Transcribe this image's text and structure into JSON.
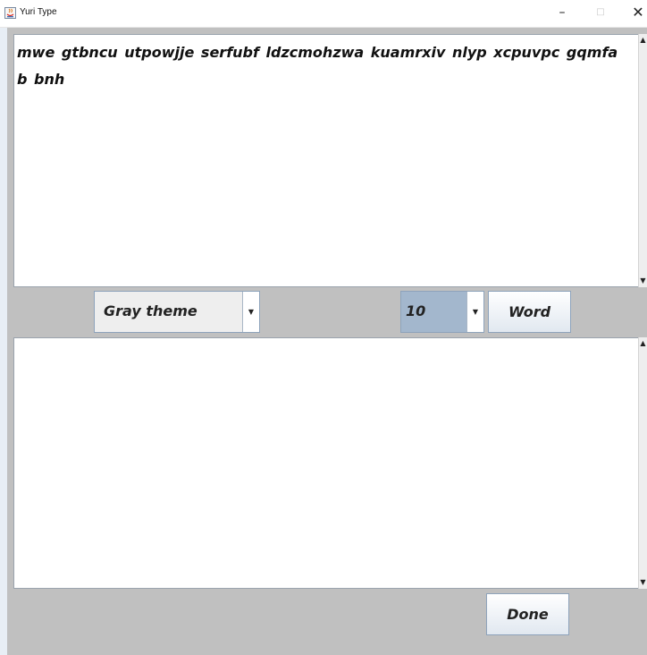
{
  "window": {
    "title": "Yuri Type",
    "minimize_glyph": "–",
    "maximize_glyph": "□",
    "close_glyph": "✕"
  },
  "prompt_text": "mwe gtbncu utpowjje serfubf ldzcmohzwa kuamrxiv nlyp xcpuvpc gqmfa b bnh",
  "input_text": "",
  "controls": {
    "theme_selected": "Gray theme",
    "word_count_selected": "10",
    "word_button_label": "Word",
    "done_button_label": "Done",
    "dropdown_arrow": "▼"
  },
  "scrollbar": {
    "up_arrow": "▲",
    "down_arrow": "▼"
  },
  "colors": {
    "background": "#c0c0c0",
    "text_area": "#ffffff",
    "selected_combo": "#a3b7cd"
  }
}
